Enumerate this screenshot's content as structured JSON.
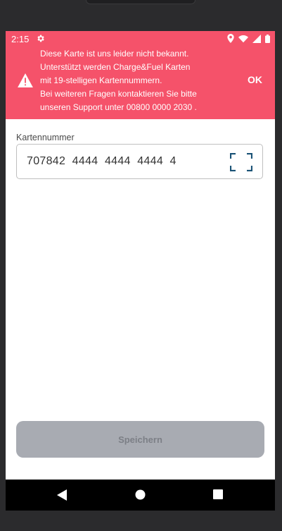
{
  "status_bar": {
    "time": "2:15",
    "icons": [
      "gear-icon",
      "location-icon",
      "wifi-icon",
      "signal-icon",
      "battery-icon"
    ]
  },
  "banner": {
    "background": "#f5526a",
    "icon": "warning-icon",
    "lines": [
      "Diese Karte ist uns leider nicht bekannt.",
      "Unterstützt werden Charge&Fuel Karten",
      "mit 19-stelligen Kartennummern.",
      "Bei weiteren Fragen kontaktieren Sie bitte",
      "unseren Support unter 00800 0000 2030 ."
    ],
    "action_label": "OK"
  },
  "form": {
    "card_number_label": "Kartennummer",
    "card_number_value": "707842  4444  4444  4444  4",
    "scan_icon": "scan-frame-icon"
  },
  "save_button": {
    "label": "Speichern",
    "disabled": true
  },
  "navigation_bar": {
    "icons": [
      "back-icon",
      "home-icon",
      "recents-icon"
    ]
  }
}
